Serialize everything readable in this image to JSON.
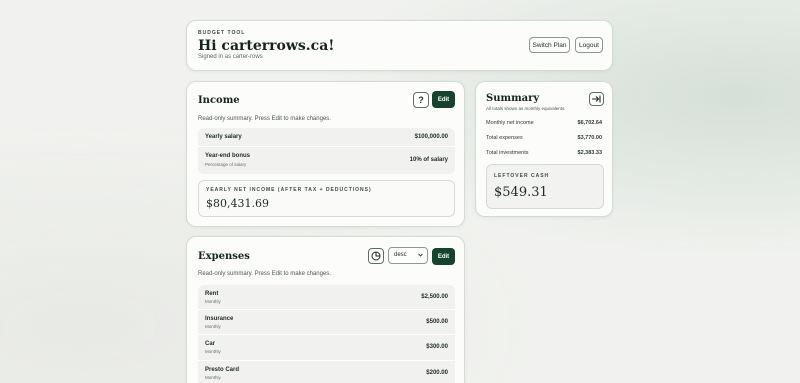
{
  "header": {
    "eyebrow": "BUDGET TOOL",
    "greeting": "Hi carterrows.ca!",
    "signed_in": "Signed in as carter-rows",
    "switch_plan_label": "Switch Plan",
    "logout_label": "Logout"
  },
  "income": {
    "title": "Income",
    "help_icon": "?",
    "edit_label": "Edit",
    "hint": "Read-only summary. Press Edit to make changes.",
    "rows": [
      {
        "label": "Yearly salary",
        "sub": "",
        "value": "$100,000.00"
      },
      {
        "label": "Year-end bonus",
        "sub": "Percentage of salary",
        "value": "10% of salary"
      }
    ],
    "net_label": "YEARLY NET INCOME (AFTER TAX + DEDUCTIONS)",
    "net_value": "$80,431.69"
  },
  "summary": {
    "title": "Summary",
    "note": "All totals shown as monthly equivalents.",
    "rows": [
      {
        "label": "Monthly net income",
        "value": "$6,702.64"
      },
      {
        "label": "Total expenses",
        "value": "$3,770.00"
      },
      {
        "label": "Total investments",
        "value": "$2,383.33"
      }
    ],
    "leftover_label": "LEFTOVER CASH",
    "leftover_value": "$549.31"
  },
  "expenses": {
    "title": "Expenses",
    "sort_value": "desc",
    "edit_label": "Edit",
    "hint": "Read-only summary. Press Edit to make changes.",
    "rows": [
      {
        "label": "Rent",
        "sub": "Monthly",
        "value": "$2,500.00"
      },
      {
        "label": "Insurance",
        "sub": "Monthly",
        "value": "$500.00"
      },
      {
        "label": "Car",
        "sub": "Monthly",
        "value": "$300.00"
      },
      {
        "label": "Presto Card",
        "sub": "Monthly",
        "value": "$200.00"
      }
    ]
  },
  "colors": {
    "accent": "#17432e",
    "background": "#f1f2ef",
    "card": "#fcfcfb"
  },
  "icons": {
    "help": "help-icon",
    "collapse": "collapse-panel-icon",
    "chart": "pie-chart-icon",
    "dropdown": "chevron-down-icon"
  }
}
